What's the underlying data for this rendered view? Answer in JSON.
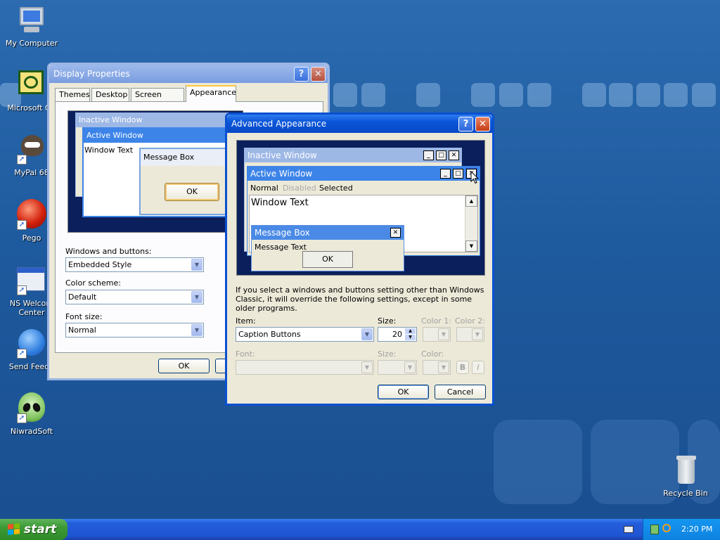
{
  "desktop": {
    "icons": [
      {
        "label": "My Computer",
        "icon": "computer-icon"
      },
      {
        "label": "Microsoft Ou",
        "icon": "outlook-icon"
      },
      {
        "label": "MyPal 68",
        "icon": "raccoon-icon"
      },
      {
        "label": "Pego",
        "icon": "red-orb-icon"
      },
      {
        "label": "NS Welcom",
        "label2": "Center",
        "icon": "window-app-icon"
      },
      {
        "label": "Send Feedb",
        "icon": "send-feedback-icon"
      },
      {
        "label": "NiwradSoft",
        "icon": "alien-icon"
      },
      {
        "label": "Recycle Bin",
        "icon": "recycle-bin-icon"
      }
    ]
  },
  "display_props": {
    "title": "Display Properties",
    "tabs": [
      "Themes",
      "Desktop",
      "Screen Saver",
      "Appearance"
    ],
    "preview": {
      "inactive": "Inactive Window",
      "active": "Active Window",
      "window_text": "Window Text",
      "msgbox": "Message Box",
      "ok": "OK"
    },
    "windows_buttons_label": "Windows and buttons:",
    "windows_buttons_value": "Embedded Style",
    "color_scheme_label": "Color scheme:",
    "color_scheme_value": "Default",
    "font_size_label": "Font size:",
    "font_size_value": "Normal",
    "ok": "OK"
  },
  "advanced": {
    "title": "Advanced Appearance",
    "preview": {
      "inactive": "Inactive Window",
      "active": "Active Window",
      "normal": "Normal",
      "disabled": "Disabled",
      "selected": "Selected",
      "window_text": "Window Text",
      "msgbox": "Message Box",
      "msg_text": "Message Text",
      "ok": "OK"
    },
    "note": "If you select a windows and buttons setting other than Windows Classic, it will override the following settings, except in some older programs.",
    "item_label": "Item:",
    "item_value": "Caption Buttons",
    "size_label": "Size:",
    "size_value": "20",
    "color1_label": "Color 1:",
    "color2_label": "Color 2:",
    "font_label": "Font:",
    "size2_label": "Size:",
    "color_label": "Color:",
    "bold": "B",
    "italic": "I",
    "ok": "OK",
    "cancel": "Cancel"
  },
  "taskbar": {
    "start": "start",
    "clock": "2:20 PM"
  }
}
